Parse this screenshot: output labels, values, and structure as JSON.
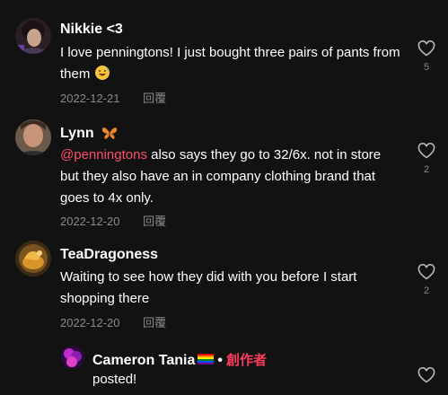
{
  "comments": [
    {
      "name": "Nikkie <3",
      "text": "I love penningtons! I just bought three pairs of pants from them",
      "emoji": "grinning-sweat-emoji",
      "date": "2022-12-21",
      "reply": "回覆",
      "likes": "5"
    },
    {
      "name": "Lynn",
      "name_emoji": "butterfly-emoji",
      "mention": "@penningtons",
      "text": " also says they go to 32/6x. not in store but they also have an in company clothing brand that goes to 4x only.",
      "date": "2022-12-20",
      "reply": "回覆",
      "likes": "2"
    },
    {
      "name": "TeaDragoness",
      "text": "Waiting to see how they did with you before I start shopping there",
      "date": "2022-12-20",
      "reply": "回覆",
      "likes": "2"
    }
  ],
  "reply_comment": {
    "name": "Cameron Tania",
    "flag": "rainbow-flag-icon",
    "creator_label": "創作者",
    "separator": "•",
    "text": "posted!"
  },
  "colors": {
    "background": "#121212",
    "mention": "#ff4d6d",
    "creator": "#ff3b5c",
    "meta": "#8a8a8a"
  }
}
